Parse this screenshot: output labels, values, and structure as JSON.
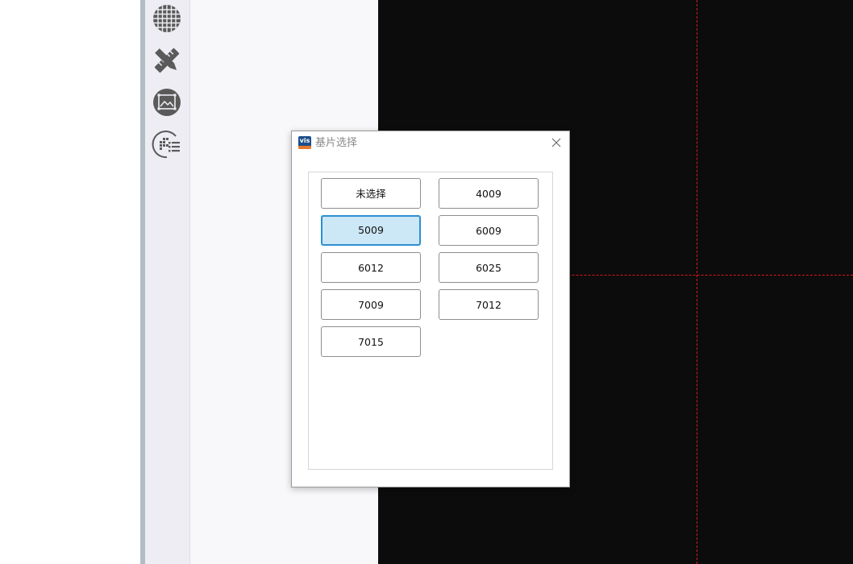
{
  "toolbar": {
    "tools": [
      {
        "icon": "grid-icon"
      },
      {
        "icon": "ruler-pencil-icon"
      },
      {
        "icon": "image-frame-icon"
      },
      {
        "icon": "pattern-list-icon"
      }
    ]
  },
  "viewport": {
    "background_color": "#0c0c0c",
    "crosshair_color": "#e0161b"
  },
  "dialog": {
    "logo_text": "vis",
    "title": "基片选择",
    "close_icon": "close-icon",
    "options": [
      {
        "label": "未选择",
        "selected": false
      },
      {
        "label": "4009",
        "selected": false
      },
      {
        "label": "5009",
        "selected": true
      },
      {
        "label": "6009",
        "selected": false
      },
      {
        "label": "6012",
        "selected": false
      },
      {
        "label": "6025",
        "selected": false
      },
      {
        "label": "7009",
        "selected": false
      },
      {
        "label": "7012",
        "selected": false
      },
      {
        "label": "7015",
        "selected": false
      }
    ]
  }
}
